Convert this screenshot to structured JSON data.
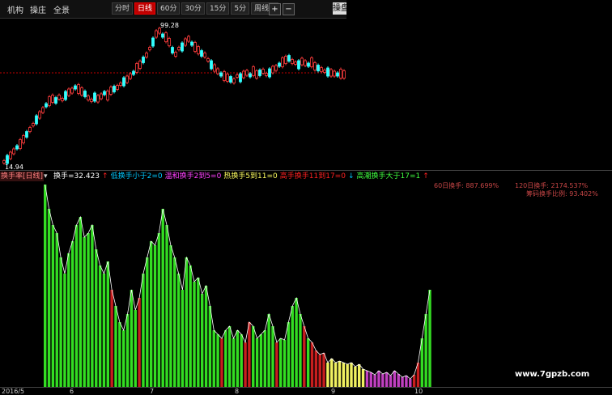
{
  "toolbar": {
    "menu": [
      "机构",
      "操庄",
      "全景"
    ],
    "periods": [
      "分时",
      "日线",
      "60分",
      "30分",
      "15分",
      "5分",
      "周线 ▾"
    ],
    "active_period": "日线",
    "plus_label": "+",
    "minus_label": "−",
    "right_tab_label": "操盘"
  },
  "price_chart": {
    "high_label": "99.28",
    "low_label": "14.94",
    "colors": {
      "up": "#ff3c3c",
      "down": "#33ffff",
      "ref_line": "#c00000"
    }
  },
  "indicator": {
    "name": "换手率[日线]",
    "name_arrow": "▾",
    "items": [
      {
        "text": "换手=32.423",
        "color": "#ffffff"
      },
      {
        "text": "↑",
        "color": "#ff2020"
      },
      {
        "text": "低换手小于2=0",
        "color": "#00c8ff"
      },
      {
        "text": "温和换手2到5=0",
        "color": "#ff40ff"
      },
      {
        "text": "热换手5到11=0",
        "color": "#ffff60"
      },
      {
        "text": "高手换手11到17=0",
        "color": "#ff2020"
      },
      {
        "text": "↓",
        "color": "#00c8ff"
      },
      {
        "text": "高潮换手大于17=1",
        "color": "#40ff40"
      },
      {
        "text": "↑",
        "color": "#ff2020"
      }
    ],
    "overlay": [
      "60日换手: 887.699%",
      "120日换手: 2174.537%",
      "筹码换手比例: 93.402%"
    ]
  },
  "turnover_chart": {
    "bar_colors": {
      "climax": "#33dd22",
      "high": "#c81e1e",
      "hot": "#f0f060",
      "mild": "#c040c0",
      "low": "#00c8ff"
    }
  },
  "x_axis": {
    "labels": [
      "2016/5",
      "6",
      "7",
      "8",
      "9",
      "10"
    ]
  },
  "watermark": "www.7gpzb.com"
}
